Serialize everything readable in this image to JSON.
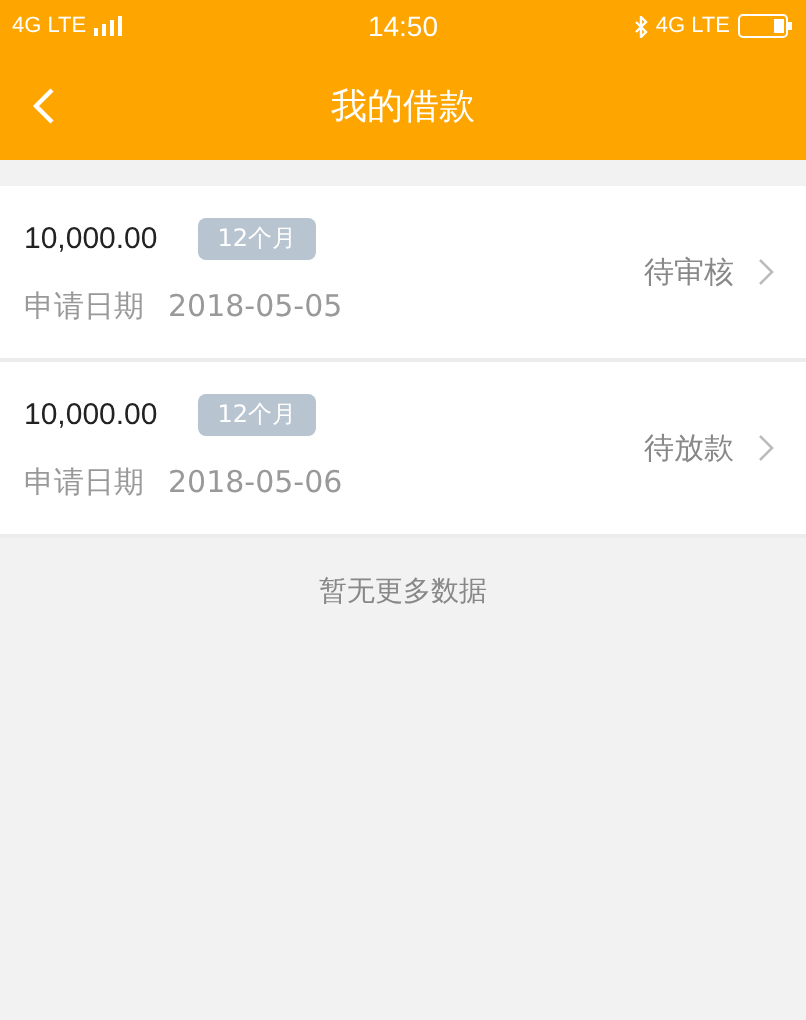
{
  "status_bar": {
    "left_network": "4G LTE",
    "time": "14:50",
    "right_network": "4G LTE"
  },
  "header": {
    "title": "我的借款"
  },
  "loans": [
    {
      "amount": "10,000.00",
      "term": "12个月",
      "date_label": "申请日期",
      "date": "2018-05-05",
      "status": "待审核"
    },
    {
      "amount": "10,000.00",
      "term": "12个月",
      "date_label": "申请日期",
      "date": "2018-05-06",
      "status": "待放款"
    }
  ],
  "footer_note": "暂无更多数据"
}
